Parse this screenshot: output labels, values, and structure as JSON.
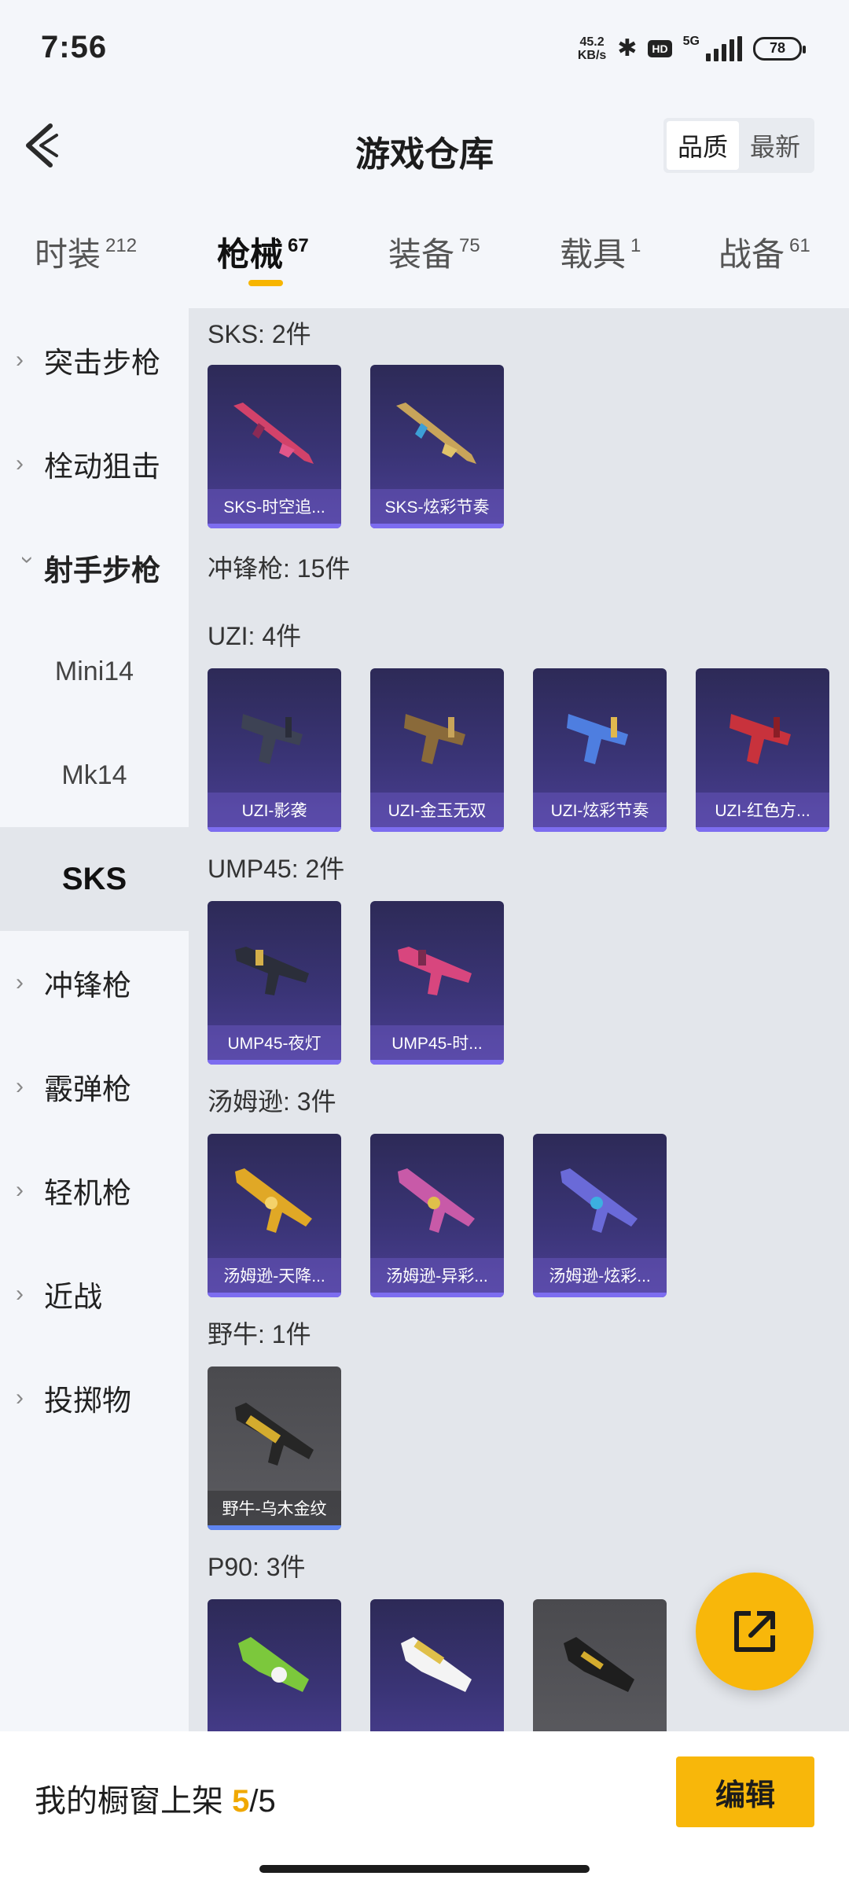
{
  "status": {
    "time": "7:56",
    "net_speed": "45.2",
    "net_unit": "KB/s",
    "hd": "HD",
    "network": "5G",
    "battery": "78"
  },
  "header": {
    "title": "游戏仓库",
    "sort_quality": "品质",
    "sort_latest": "最新"
  },
  "tabs": [
    {
      "label": "时装",
      "count": "212"
    },
    {
      "label": "枪械",
      "count": "67"
    },
    {
      "label": "装备",
      "count": "75"
    },
    {
      "label": "载具",
      "count": "1"
    },
    {
      "label": "战备",
      "count": "61"
    }
  ],
  "sidebar": {
    "items": [
      "突击步枪",
      "栓动狙击",
      "射手步枪",
      "Mini14",
      "Mk14",
      "SKS",
      "冲锋枪",
      "霰弹枪",
      "轻机枪",
      "近战",
      "投掷物"
    ]
  },
  "sections": {
    "sks": {
      "title": "SKS: 2件",
      "items": [
        "SKS-时空追...",
        "SKS-炫彩节奏"
      ]
    },
    "smg": {
      "title": "冲锋枪: 15件"
    },
    "uzi": {
      "title": "UZI: 4件",
      "items": [
        "UZI-影袭",
        "UZI-金玉无双",
        "UZI-炫彩节奏",
        "UZI-红色方..."
      ]
    },
    "ump": {
      "title": "UMP45: 2件",
      "items": [
        "UMP45-夜灯",
        "UMP45-时..."
      ]
    },
    "tommy": {
      "title": "汤姆逊: 3件",
      "items": [
        "汤姆逊-天降...",
        "汤姆逊-异彩...",
        "汤姆逊-炫彩..."
      ]
    },
    "bizon": {
      "title": "野牛: 1件",
      "items": [
        "野牛-乌木金纹"
      ]
    },
    "p90": {
      "title": "P90: 3件"
    }
  },
  "bottom": {
    "text": "我的橱窗上架",
    "count": "5",
    "sep": "/",
    "total": "5",
    "edit": "编辑"
  },
  "colors": {
    "accent": "#f8b70a",
    "card_purple": "#3a3476",
    "card_gray": "#5c5c61"
  }
}
